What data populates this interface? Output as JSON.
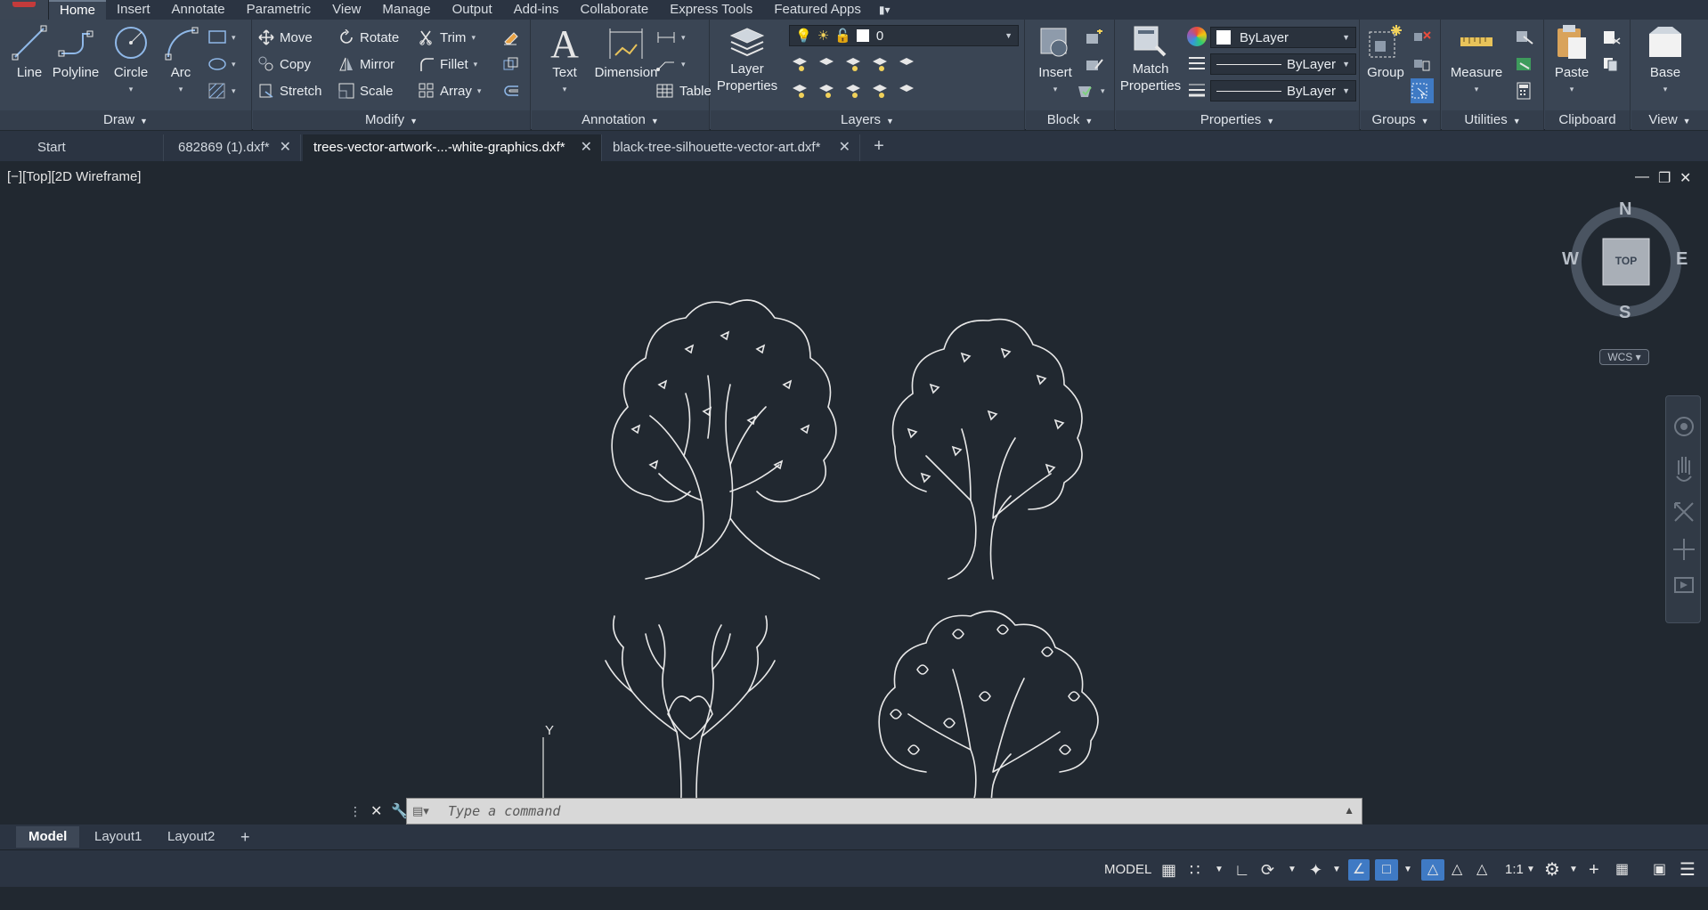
{
  "menu": {
    "tabs": [
      "Home",
      "Insert",
      "Annotate",
      "Parametric",
      "View",
      "Manage",
      "Output",
      "Add-ins",
      "Collaborate",
      "Express Tools",
      "Featured Apps"
    ],
    "active_index": 0
  },
  "ribbon": {
    "draw": {
      "title": "Draw",
      "line": "Line",
      "polyline": "Polyline",
      "circle": "Circle",
      "arc": "Arc"
    },
    "modify": {
      "title": "Modify",
      "move": "Move",
      "rotate": "Rotate",
      "trim": "Trim",
      "copy": "Copy",
      "mirror": "Mirror",
      "fillet": "Fillet",
      "stretch": "Stretch",
      "scale": "Scale",
      "array": "Array"
    },
    "annotation": {
      "title": "Annotation",
      "text": "Text",
      "dimension": "Dimension",
      "table": "Table"
    },
    "layers": {
      "title": "Layers",
      "layer_properties_1": "Layer",
      "layer_properties_2": "Properties",
      "current_layer": "0"
    },
    "block": {
      "title": "Block",
      "insert": "Insert"
    },
    "properties": {
      "title": "Properties",
      "match_1": "Match",
      "match_2": "Properties",
      "color": "ByLayer",
      "linetype": "ByLayer",
      "lineweight": "ByLayer"
    },
    "groups": {
      "title": "Groups",
      "group": "Group"
    },
    "utilities": {
      "title": "Utilities",
      "measure": "Measure"
    },
    "clipboard": {
      "title": "Clipboard",
      "paste": "Paste"
    },
    "view": {
      "title": "View",
      "base": "Base"
    }
  },
  "documents": {
    "start": "Start",
    "tabs": [
      "682869 (1).dxf*",
      "trees-vector-artwork-...-white-graphics.dxf*",
      "black-tree-silhouette-vector-art.dxf*"
    ],
    "active_index": 1
  },
  "viewport": {
    "label": "[−][Top][2D Wireframe]",
    "viewcube": {
      "n": "N",
      "s": "S",
      "e": "E",
      "w": "W",
      "face": "TOP"
    },
    "wcs": "WCS",
    "ucs_y": "Y"
  },
  "command": {
    "placeholder": "Type a command"
  },
  "layouts": {
    "tabs": [
      "Model",
      "Layout1",
      "Layout2"
    ],
    "active_index": 0
  },
  "status": {
    "model": "MODEL",
    "scale": "1:1"
  },
  "colors": {
    "canvas": "#212830",
    "ribbon": "#3a4554",
    "accent": "#3f7ac4"
  }
}
